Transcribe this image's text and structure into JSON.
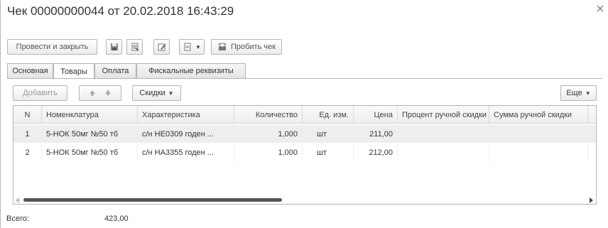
{
  "window": {
    "title": "Чек 00000000044 от 20.02.2018 16:43:29",
    "close_icon": "close-icon"
  },
  "toolbar": {
    "post_close_label": "Провести и закрыть",
    "save_icon": "save-icon",
    "doc_icon": "document-icon",
    "edit_icon": "edit-icon",
    "more_icon": "list-icon",
    "print_check_label": "Пробить чек",
    "print_check_icon": "receipt-icon"
  },
  "tabs": [
    {
      "label": "Основная"
    },
    {
      "label": "Товары"
    },
    {
      "label": "Оплата"
    },
    {
      "label": "Фискальные реквизиты"
    }
  ],
  "grid_toolbar": {
    "add_label": "Добавить",
    "up_icon": "arrow-up-icon",
    "down_icon": "arrow-down-icon",
    "discounts_label": "Скидки",
    "more_label": "Еще"
  },
  "table": {
    "columns": [
      "N",
      "Номенклатура",
      "Характеристика",
      "Количество",
      "Ед. изм.",
      "Цена",
      "Процент ручной скидки",
      "Сумма ручной скидки"
    ],
    "rows": [
      [
        "1",
        "5-НОК 50мг №50 тб",
        "с/н НЕ0309 годен ...",
        "1,000",
        "шт",
        "211,00",
        "",
        ""
      ],
      [
        "2",
        "5-НОК 50мг №50 тб",
        "с/н НА3355 годен ...",
        "1,000",
        "шт",
        "212,00",
        "",
        ""
      ]
    ],
    "selected_row": 0
  },
  "footer": {
    "total_label": "Всего:",
    "total_value": "423,00"
  },
  "colors": {
    "selected_row_bg": "#eeeeee",
    "border": "#b5b5b5"
  }
}
